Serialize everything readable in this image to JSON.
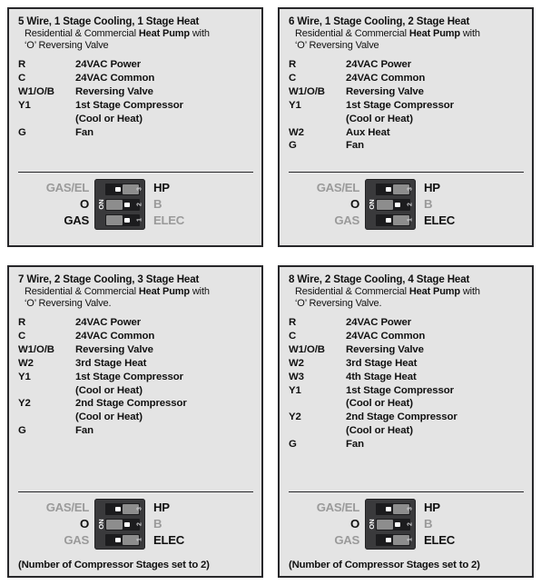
{
  "page": {
    "background": "#ffffff",
    "panel_background": "#e4e4e4",
    "panel_border": "#27272a",
    "text_on_color": "#111111",
    "text_off_color": "#9a9a9a",
    "switch_body_color": "#3a3a3c"
  },
  "panels": [
    {
      "id": "panel-5-wire",
      "title": "5 Wire, 1 Stage Cooling, 1 Stage Heat",
      "subtitle_pre": "Residential & Commercial ",
      "subtitle_bold": "Heat Pump",
      "subtitle_post": " with",
      "subtitle_line2": "‘O’ Reversing Valve",
      "terminals": [
        {
          "key": "R",
          "value": "24VAC Power"
        },
        {
          "key": "C",
          "value": "24VAC Common"
        },
        {
          "key": "W1/O/B",
          "value": "Reversing Valve"
        },
        {
          "key": "Y1",
          "value": "1st Stage Compressor",
          "cont": "(Cool or Heat)"
        },
        {
          "key": "G",
          "value": "Fan"
        }
      ],
      "switch": {
        "on_label": "ON",
        "rows": [
          {
            "num": "3",
            "position": "right"
          },
          {
            "num": "2",
            "position": "left"
          },
          {
            "num": "1",
            "position": "left"
          }
        ]
      },
      "left_labels": [
        {
          "text": "GAS/EL",
          "state": "off"
        },
        {
          "text": "O",
          "state": "on"
        },
        {
          "text": "GAS",
          "state": "on"
        }
      ],
      "right_labels": [
        {
          "text": "HP",
          "state": "on"
        },
        {
          "text": "B",
          "state": "off"
        },
        {
          "text": "ELEC",
          "state": "off"
        }
      ],
      "note": ""
    },
    {
      "id": "panel-6-wire",
      "title": "6 Wire, 1 Stage Cooling, 2 Stage Heat",
      "subtitle_pre": "Residential & Commercial ",
      "subtitle_bold": "Heat Pump",
      "subtitle_post": " with",
      "subtitle_line2": "‘O’ Reversing Valve",
      "terminals": [
        {
          "key": "R",
          "value": "24VAC Power"
        },
        {
          "key": "C",
          "value": "24VAC Common"
        },
        {
          "key": "W1/O/B",
          "value": "Reversing Valve"
        },
        {
          "key": "Y1",
          "value": "1st Stage Compressor",
          "cont": "(Cool or Heat)"
        },
        {
          "key": "W2",
          "value": "Aux Heat"
        },
        {
          "key": "G",
          "value": "Fan"
        }
      ],
      "switch": {
        "on_label": "ON",
        "rows": [
          {
            "num": "3",
            "position": "right"
          },
          {
            "num": "2",
            "position": "left"
          },
          {
            "num": "1",
            "position": "right"
          }
        ]
      },
      "left_labels": [
        {
          "text": "GAS/EL",
          "state": "off"
        },
        {
          "text": "O",
          "state": "on"
        },
        {
          "text": "GAS",
          "state": "off"
        }
      ],
      "right_labels": [
        {
          "text": "HP",
          "state": "on"
        },
        {
          "text": "B",
          "state": "off"
        },
        {
          "text": "ELEC",
          "state": "on"
        }
      ],
      "note": ""
    },
    {
      "id": "panel-7-wire",
      "title": "7 Wire, 2 Stage Cooling, 3 Stage Heat",
      "subtitle_pre": "Residential & Commercial ",
      "subtitle_bold": "Heat Pump",
      "subtitle_post": " with",
      "subtitle_line2": "‘O’ Reversing Valve.",
      "terminals": [
        {
          "key": "R",
          "value": "24VAC Power"
        },
        {
          "key": "C",
          "value": "24VAC Common"
        },
        {
          "key": "W1/O/B",
          "value": "Reversing Valve"
        },
        {
          "key": "W2",
          "value": "3rd Stage Heat"
        },
        {
          "key": "Y1",
          "value": "1st Stage Compressor",
          "cont": "(Cool or Heat)"
        },
        {
          "key": "Y2",
          "value": "2nd Stage Compressor",
          "cont": "(Cool or Heat)"
        },
        {
          "key": "G",
          "value": "Fan"
        }
      ],
      "switch": {
        "on_label": "ON",
        "rows": [
          {
            "num": "3",
            "position": "right"
          },
          {
            "num": "2",
            "position": "left"
          },
          {
            "num": "1",
            "position": "right"
          }
        ]
      },
      "left_labels": [
        {
          "text": "GAS/EL",
          "state": "off"
        },
        {
          "text": "O",
          "state": "on"
        },
        {
          "text": "GAS",
          "state": "off"
        }
      ],
      "right_labels": [
        {
          "text": "HP",
          "state": "on"
        },
        {
          "text": "B",
          "state": "off"
        },
        {
          "text": "ELEC",
          "state": "on"
        }
      ],
      "note": "(Number of Compressor Stages set to 2)"
    },
    {
      "id": "panel-8-wire",
      "title": "8 Wire, 2 Stage Cooling, 4 Stage Heat",
      "subtitle_pre": "Residential & Commercial ",
      "subtitle_bold": "Heat Pump",
      "subtitle_post": " with",
      "subtitle_line2": "‘O’ Reversing Valve.",
      "terminals": [
        {
          "key": "R",
          "value": "24VAC Power"
        },
        {
          "key": "C",
          "value": "24VAC Common"
        },
        {
          "key": "W1/O/B",
          "value": "Reversing Valve"
        },
        {
          "key": "W2",
          "value": "3rd Stage Heat"
        },
        {
          "key": "W3",
          "value": "4th Stage Heat"
        },
        {
          "key": "Y1",
          "value": "1st Stage Compressor",
          "cont": "(Cool or Heat)"
        },
        {
          "key": "Y2",
          "value": "2nd Stage Compressor",
          "cont": "(Cool or Heat)"
        },
        {
          "key": "G",
          "value": "Fan"
        }
      ],
      "switch": {
        "on_label": "ON",
        "rows": [
          {
            "num": "3",
            "position": "right"
          },
          {
            "num": "2",
            "position": "left"
          },
          {
            "num": "1",
            "position": "right"
          }
        ]
      },
      "left_labels": [
        {
          "text": "GAS/EL",
          "state": "off"
        },
        {
          "text": "O",
          "state": "on"
        },
        {
          "text": "GAS",
          "state": "off"
        }
      ],
      "right_labels": [
        {
          "text": "HP",
          "state": "on"
        },
        {
          "text": "B",
          "state": "off"
        },
        {
          "text": "ELEC",
          "state": "on"
        }
      ],
      "note": "(Number of Compressor Stages set to 2)"
    }
  ]
}
